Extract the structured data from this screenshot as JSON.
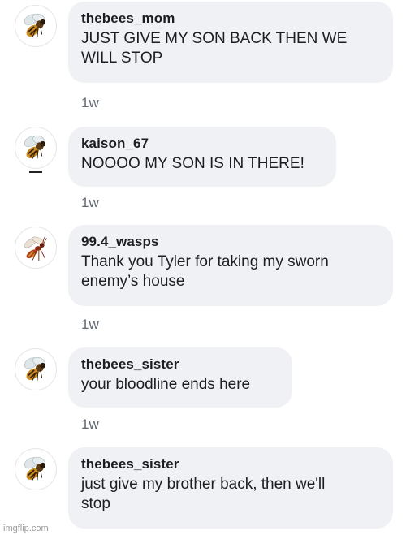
{
  "comments": [
    {
      "username": "thebees_mom",
      "text": "JUST GIVE MY SON BACK THEN WE\nWILL STOP",
      "time": "1w",
      "avatar_icon": "bee-icon"
    },
    {
      "username": "kaison_67",
      "text": "NOOOO MY SON IS IN THERE!",
      "time": "1w",
      "avatar_icon": "bee-icon"
    },
    {
      "username": "99.4_wasps",
      "text": "Thank you Tyler for taking my sworn\nenemy’s house",
      "time": "1w",
      "avatar_icon": "wasp-icon"
    },
    {
      "username": "thebees_sister",
      "text": "your bloodline ends here",
      "time": "1w",
      "avatar_icon": "bee-icon"
    },
    {
      "username": "thebees_sister",
      "text": "just give my brother back, then we'll\nstop",
      "avatar_icon": "bee-icon"
    }
  ],
  "watermark": "imgflip.com",
  "colors": {
    "bubble": "#eff1f4",
    "text": "#1c1e21",
    "timestamp": "#606770"
  }
}
